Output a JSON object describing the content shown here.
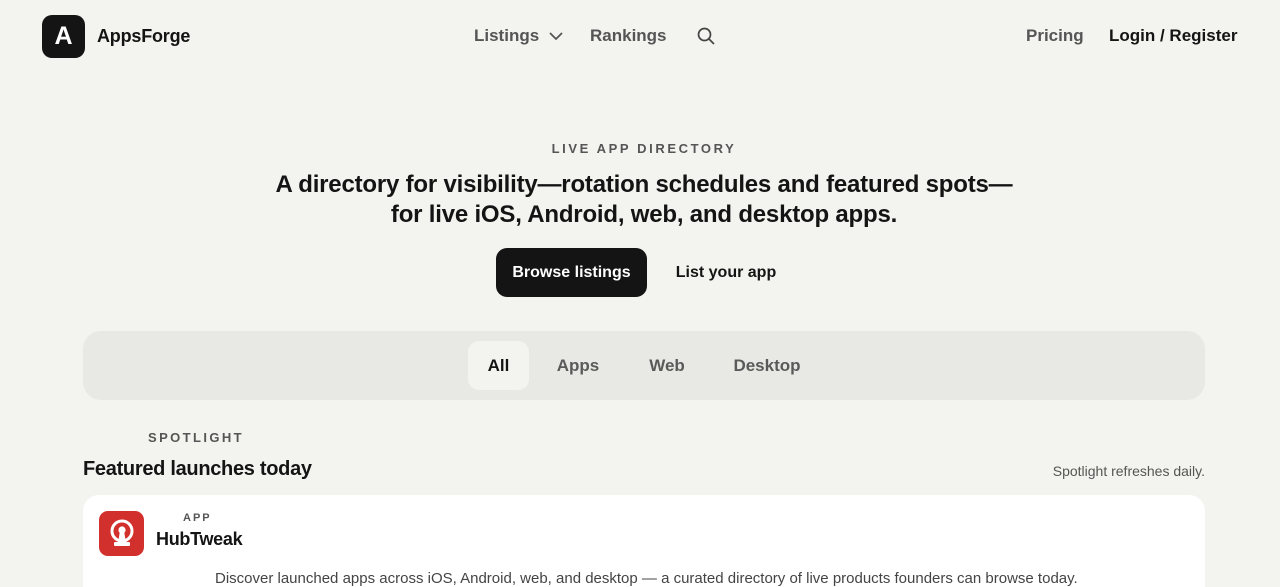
{
  "brand": {
    "logo_letter": "A",
    "name": "AppsForge"
  },
  "nav": {
    "listings": "Listings",
    "rankings": "Rankings",
    "search_icon": "search-icon",
    "pricing": "Pricing",
    "login": "Login / Register"
  },
  "hero": {
    "eyebrow": "LIVE APP DIRECTORY",
    "title_line1": "A directory for visibility—rotation schedules and featured spots—",
    "title_line2": "for live iOS, Android, web, and desktop apps.",
    "primary_cta": "Browse listings",
    "secondary_cta": "List your app"
  },
  "filters": {
    "tabs": [
      {
        "label": "All",
        "active": true
      },
      {
        "label": "Apps",
        "active": false
      },
      {
        "label": "Web",
        "active": false
      },
      {
        "label": "Desktop",
        "active": false
      }
    ]
  },
  "spotlight": {
    "eyebrow": "SPOTLIGHT",
    "title": "Featured launches today",
    "note": "Spotlight refreshes daily.",
    "items": [
      {
        "kind": "APP",
        "name": "HubTweak",
        "icon": "keyhole-icon",
        "icon_color": "#d2302c",
        "description": "Discover launched apps across iOS, Android, web, and desktop — a curated directory of live products founders can browse today."
      }
    ]
  },
  "colors": {
    "background": "#f3f3ef",
    "ink": "#141414",
    "accent": "#d2302c"
  }
}
